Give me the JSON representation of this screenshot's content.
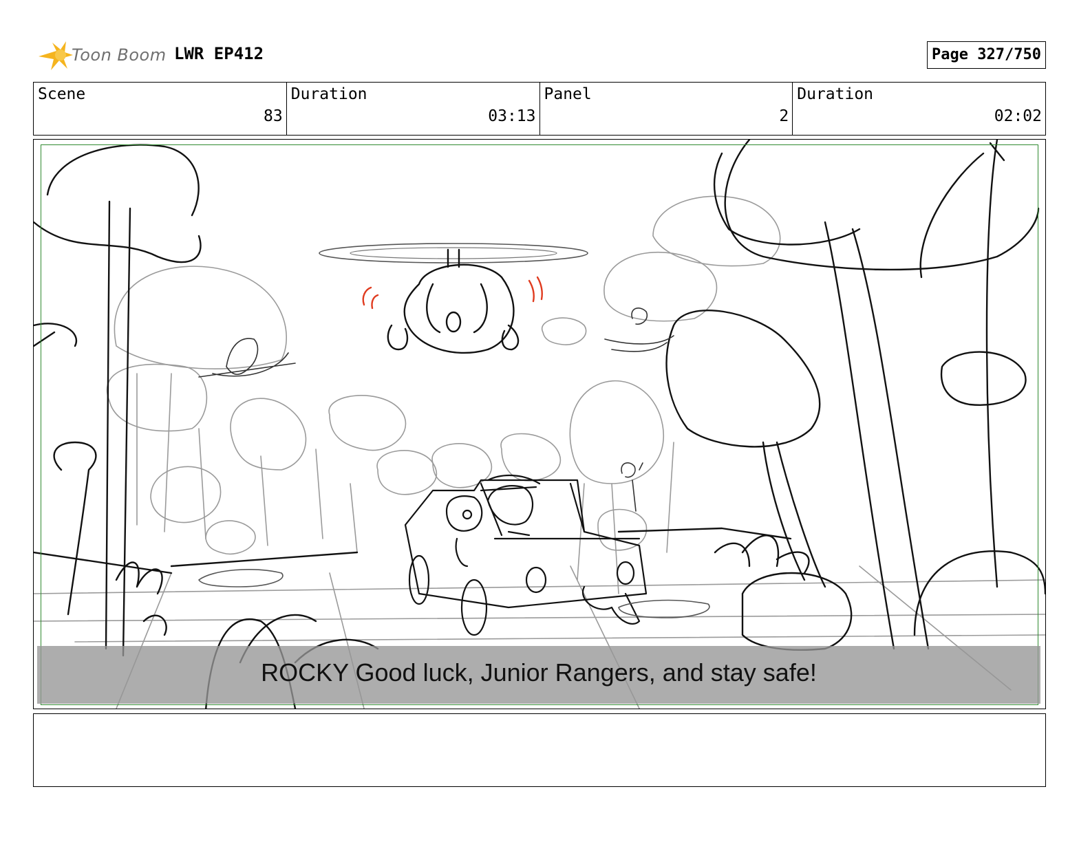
{
  "header": {
    "logo_text": "Toon Boom",
    "project_title": "LWR EP412",
    "page_label": "Page 327/750"
  },
  "info": {
    "scene_label": "Scene",
    "scene_value": "83",
    "scene_duration_label": "Duration",
    "scene_duration_value": "03:13",
    "panel_label": "Panel",
    "panel_value": "2",
    "panel_duration_label": "Duration",
    "panel_duration_value": "02:02"
  },
  "panel": {
    "caption": "ROCKY Good luck, Junior Rangers, and stay safe!"
  },
  "colors": {
    "frame_green": "#2f8a2f",
    "caption_gray": "#969696",
    "logo_yellow": "#f5b41e",
    "sketch_red": "#e03b1f"
  }
}
